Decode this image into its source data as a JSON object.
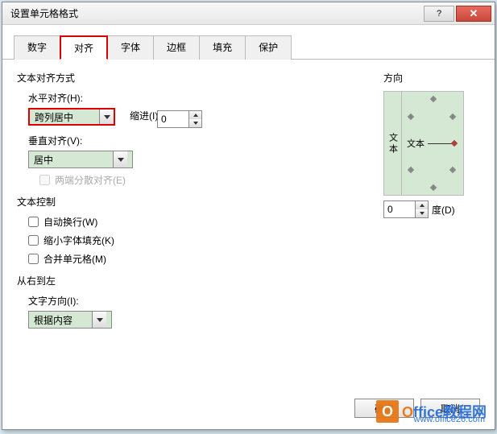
{
  "window": {
    "title": "设置单元格格式"
  },
  "tabs": {
    "number": "数字",
    "alignment": "对齐",
    "font": "字体",
    "border": "边框",
    "fill": "填充",
    "protection": "保护"
  },
  "align": {
    "group": "文本对齐方式",
    "h_label": "水平对齐(H):",
    "h_value": "跨列居中",
    "indent_label": "缩进(I):",
    "indent_value": "0",
    "v_label": "垂直对齐(V):",
    "v_value": "居中",
    "justify": "两端分散对齐(E)"
  },
  "ctrl": {
    "group": "文本控制",
    "wrap": "自动换行(W)",
    "shrink": "缩小字体填充(K)",
    "merge": "合并单元格(M)"
  },
  "rtl": {
    "group": "从右到左",
    "dir_label": "文字方向(I):",
    "dir_value": "根据内容"
  },
  "orient": {
    "group": "方向",
    "vtext": "文 本",
    "htext": "文本",
    "deg_value": "0",
    "deg_label": "度(D)"
  },
  "buttons": {
    "ok": "确定",
    "cancel": "取消"
  },
  "watermark": {
    "brand1": "O",
    "brand2": "ffice",
    "brand3": "教程网",
    "url": "www.office26.com"
  }
}
